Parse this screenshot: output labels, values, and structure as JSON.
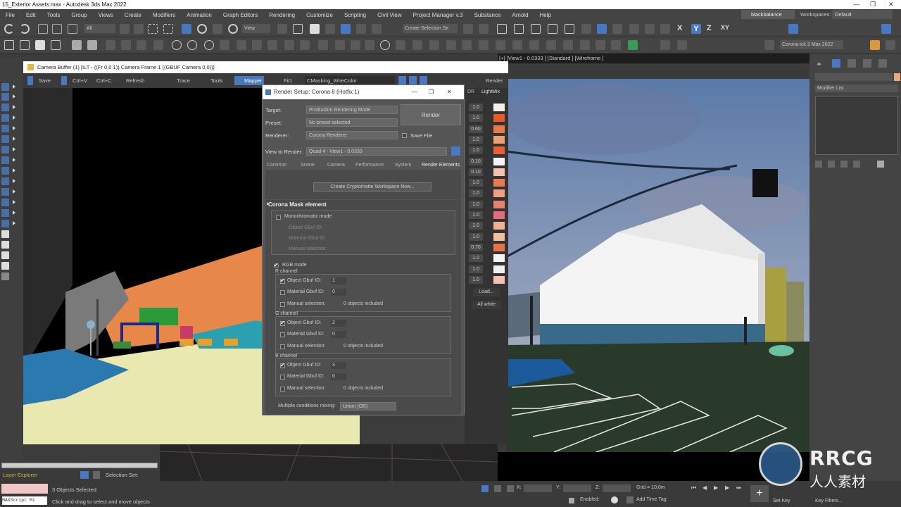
{
  "window": {
    "title": "15_Exterior Assets.max - Autodesk 3ds Max 2022"
  },
  "menubar": {
    "items": [
      "File",
      "Edit",
      "Tools",
      "Group",
      "Views",
      "Create",
      "Modifiers",
      "Animation",
      "Graph Editors",
      "Rendering",
      "Customize",
      "Scripting",
      "Civil View",
      "Project Manager v.3",
      "Substance",
      "Arnold",
      "Help"
    ],
    "user": "blackbalance",
    "workspaces_label": "Workspaces:",
    "workspaces_value": "Default"
  },
  "toolbar": {
    "selection_filter": "All",
    "view_dropdown": "View",
    "selection_set": "Create Selection Se",
    "scene_explorer": "Corona-ick 3 Max 2022"
  },
  "viewport_right": {
    "label": "[+] [View1 - 0.0333 ] [Standard ] [Wireframe ]"
  },
  "frame_buffer": {
    "title": "Camera Buffer (1) [ILT - ((Fr 0.0 1)) Camera Frame 1 ((GBUF Camera 0.0))]",
    "toolbar": [
      "Save",
      "Ctrl+C",
      "Refresh",
      "Trace",
      "Tools",
      "Mapper",
      "Fit1",
      "CMasking_WireColor"
    ],
    "ctrl_label": "Ctrl+V",
    "lightmix_label": "LightMix",
    "render_label": "Render",
    "dr_label": "DR",
    "load_label": "Load...",
    "all_white_label": "All white",
    "swatches": [
      {
        "value": "1.0",
        "color": "#f4f0e8"
      },
      {
        "value": "1.0",
        "color": "#e85a2a"
      },
      {
        "value": "0.60",
        "color": "#e87a4a"
      },
      {
        "value": "1.0",
        "color": "#f0a070"
      },
      {
        "value": "1.0",
        "color": "#e8603a"
      },
      {
        "value": "0.10",
        "color": "#f4f4f4"
      },
      {
        "value": "0.10",
        "color": "#f4c0b0"
      },
      {
        "value": "1.0",
        "color": "#e87a50"
      },
      {
        "value": "1.0",
        "color": "#f0a080"
      },
      {
        "value": "1.0",
        "color": "#e88070"
      },
      {
        "value": "1.0",
        "color": "#e86a7a"
      },
      {
        "value": "1.0",
        "color": "#f0b090"
      },
      {
        "value": "1.0",
        "color": "#f0c0a0"
      },
      {
        "value": "0.70",
        "color": "#e8704a"
      },
      {
        "value": "1.0",
        "color": "#f4f4f4"
      },
      {
        "value": "1.0",
        "color": "#f0f0f0"
      },
      {
        "value": "1.0",
        "color": "#f4c0b0"
      }
    ]
  },
  "render_setup": {
    "title": "Render Setup: Corona 8 (Hotfix 1)",
    "target_label": "Target:",
    "target_value": "Production Rendering Mode",
    "preset_label": "Preset:",
    "preset_value": "No preset selected",
    "renderer_label": "Renderer:",
    "renderer_value": "Corona Renderer",
    "save_file_label": "Save File",
    "render_button": "Render",
    "view_label": "View to Render:",
    "view_value": "Quad 4 - View1 - 0.0333",
    "tabs": [
      "Common",
      "Scene",
      "Camera",
      "Performance",
      "System",
      "Render Elements"
    ],
    "create_btn": "Create Cryptomatte Workspace Now...",
    "section_title": "Corona Mask element",
    "mono_label": "Monochromatic mode",
    "mono_rows": [
      "Object Gbuf ID:",
      "Material Gbuf ID:",
      "Manual selection:"
    ],
    "rgb_label": "RGB mode",
    "channels": [
      {
        "name": "R channel",
        "object_id": "1",
        "material_id": "0",
        "manual": "0 objects included"
      },
      {
        "name": "G channel",
        "object_id": "2",
        "material_id": "0",
        "manual": "0 objects included"
      },
      {
        "name": "B channel",
        "object_id": "3",
        "material_id": "0",
        "manual": "0 objects included"
      }
    ],
    "object_label": "Object Gbuf ID:",
    "material_label": "Material Gbuf ID:",
    "manual_label": "Manual selection:",
    "multiple_label": "Multiple conditions mixing:",
    "multiple_value": "Union (OR)"
  },
  "command_panel": {
    "modifier_list": "Modifier List"
  },
  "status": {
    "layer_explorer": "Layer Explorer",
    "selection_set": "Selection Set:",
    "objects_selected": "3 Objects Selected",
    "hint": "Click and drag to select and move objects",
    "maxscript": "MAXScript Mi",
    "x_label": "X:",
    "y_label": "Y:",
    "z_label": "Z:",
    "grid": "Grid = 10,0m",
    "enabled": "Enabled:",
    "add_time_tag": "Add Time Tag",
    "set_key": "Set Key",
    "key_filters": "Key Filters..."
  },
  "watermark": {
    "big": "RRCG",
    "cn": "人人素材"
  },
  "colors": {
    "accent_blue": "#4a78c0",
    "orange_wall": "#e8874a",
    "ground": "#e8e8b0"
  }
}
